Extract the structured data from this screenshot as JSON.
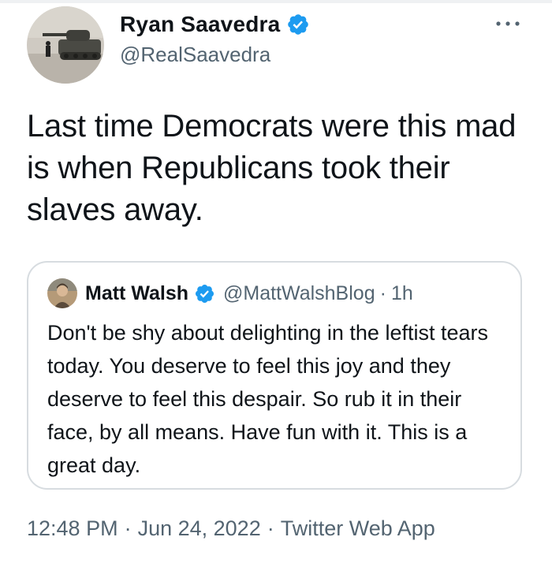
{
  "author": {
    "name": "Ryan Saavedra",
    "handle": "@RealSaavedra",
    "verified": true,
    "avatar_icon": "tank-photo-avatar"
  },
  "tweet": {
    "text": "Last time Democrats were this mad is when Republicans took their slaves away."
  },
  "quote": {
    "name": "Matt Walsh",
    "handle": "@MattWalshBlog",
    "separator": "·",
    "time": "1h",
    "verified": true,
    "avatar_icon": "person-photo-avatar",
    "text": "Don't be shy about delighting in the leftist tears today. You deserve to feel this joy and they deserve to feel this despair. So rub it in their face, by all means. Have fun with it. This is a great day."
  },
  "meta": {
    "time": "12:48 PM",
    "separator": "·",
    "date": "Jun 24, 2022",
    "source": "Twitter Web App"
  },
  "colors": {
    "text": "#0f1419",
    "secondary": "#536471",
    "verified": "#1d9bf0",
    "border": "#d7dce0"
  }
}
